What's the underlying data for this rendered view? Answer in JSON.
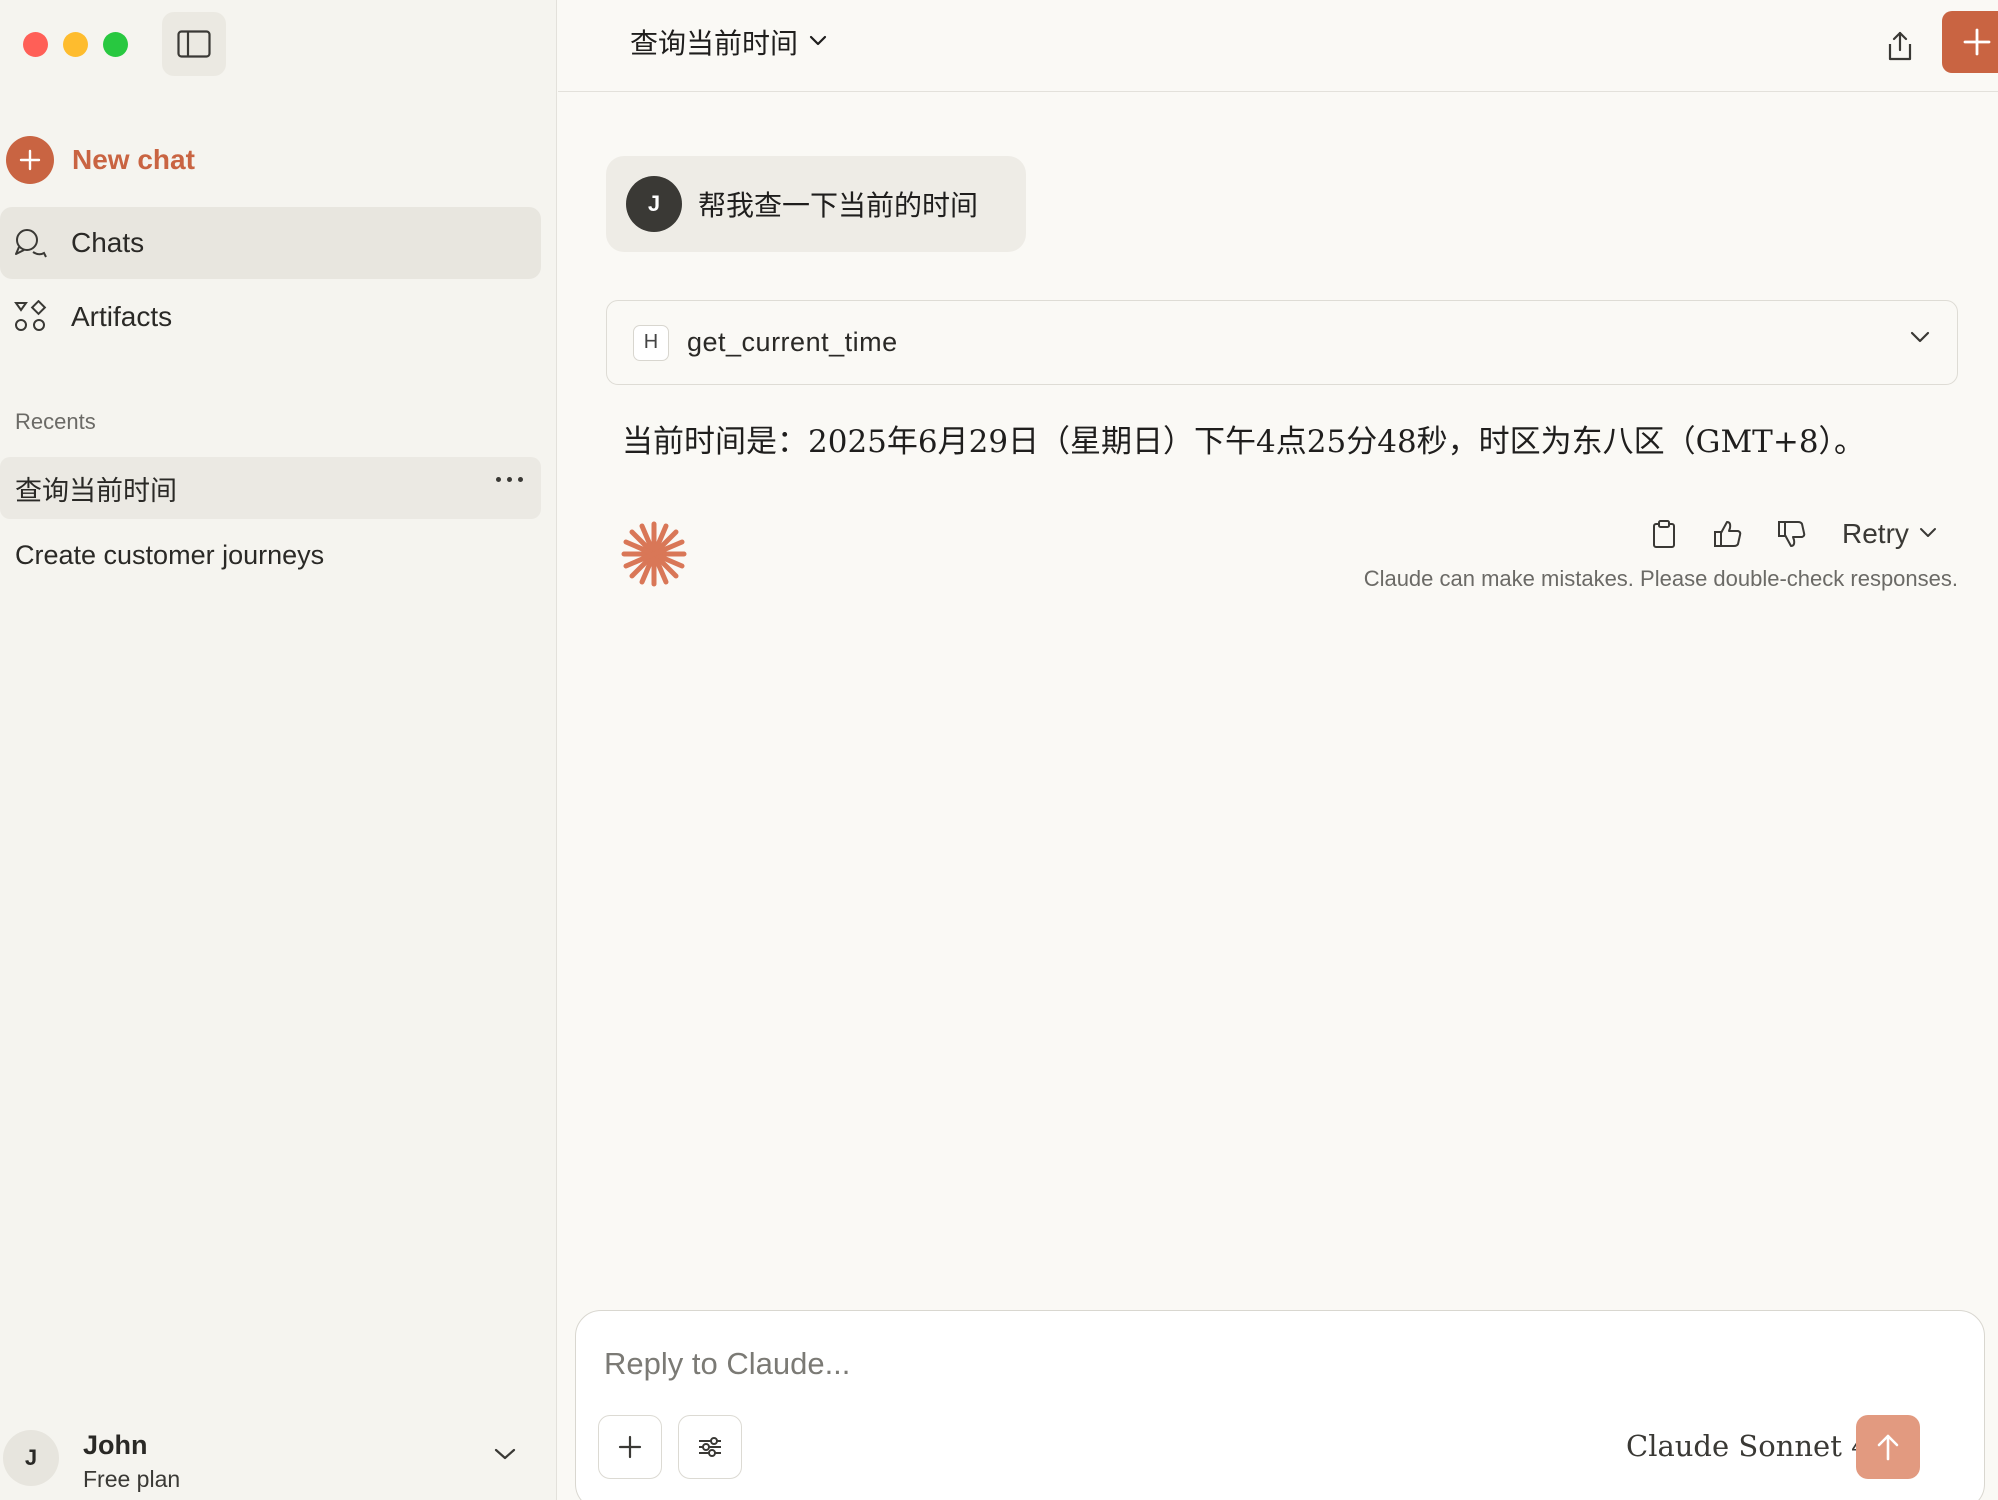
{
  "sidebar": {
    "new_chat_label": "New chat",
    "nav": [
      {
        "label": "Chats",
        "icon": "chat-bubbles-icon",
        "active": true
      },
      {
        "label": "Artifacts",
        "icon": "shapes-icon",
        "active": false
      }
    ],
    "recents_title": "Recents",
    "recents": [
      {
        "label": "查询当前时间",
        "active": true
      },
      {
        "label": "Create customer journeys",
        "active": false
      }
    ],
    "user": {
      "initial": "J",
      "name": "John",
      "plan": "Free plan"
    }
  },
  "header": {
    "title": "查询当前时间"
  },
  "conversation": {
    "user_message": {
      "avatar_initial": "J",
      "text": "帮我查一下当前的时间"
    },
    "tool_call": {
      "badge": "H",
      "name": "get_current_time"
    },
    "assistant_text": "当前时间是：2025年6月29日（星期日）下午4点25分48秒，时区为东八区（GMT+8）。",
    "retry_label": "Retry",
    "disclaimer": "Claude can make mistakes. Please double-check responses."
  },
  "composer": {
    "placeholder": "Reply to Claude...",
    "model": "Claude Sonnet 4"
  },
  "colors": {
    "accent": "#c96442",
    "send_disabled": "#e29a80",
    "background": "#faf9f5",
    "sidebar": "#f5f4ef"
  }
}
